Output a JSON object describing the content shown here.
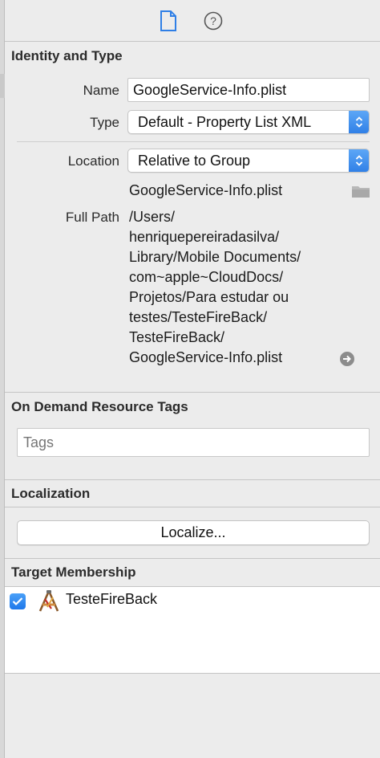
{
  "toolbar": {
    "file_icon": "file-inspector-icon",
    "help_icon": "quick-help-icon",
    "help_glyph": "?"
  },
  "identity": {
    "title": "Identity and Type",
    "name_label": "Name",
    "name_value": "GoogleService-Info.plist",
    "type_label": "Type",
    "type_value": "Default - Property List XML",
    "location_label": "Location",
    "location_value": "Relative to Group",
    "file_name": "GoogleService-Info.plist",
    "full_path_label": "Full Path",
    "full_path_lines": [
      "/Users/",
      "henriquepereiradasilva/",
      "Library/Mobile Documents/",
      "com~apple~CloudDocs/",
      "Projetos/Para estudar ou",
      "testes/TesteFireBack/",
      "TesteFireBack/",
      "GoogleService-Info.plist"
    ]
  },
  "on_demand": {
    "title": "On Demand Resource Tags",
    "tags_placeholder": "Tags"
  },
  "localization": {
    "title": "Localization",
    "button_label": "Localize..."
  },
  "target_membership": {
    "title": "Target Membership",
    "targets": [
      {
        "name": "TesteFireBack",
        "checked": true
      }
    ]
  },
  "colors": {
    "accent": "#2f7fe6",
    "panel_bg": "#ececec"
  }
}
